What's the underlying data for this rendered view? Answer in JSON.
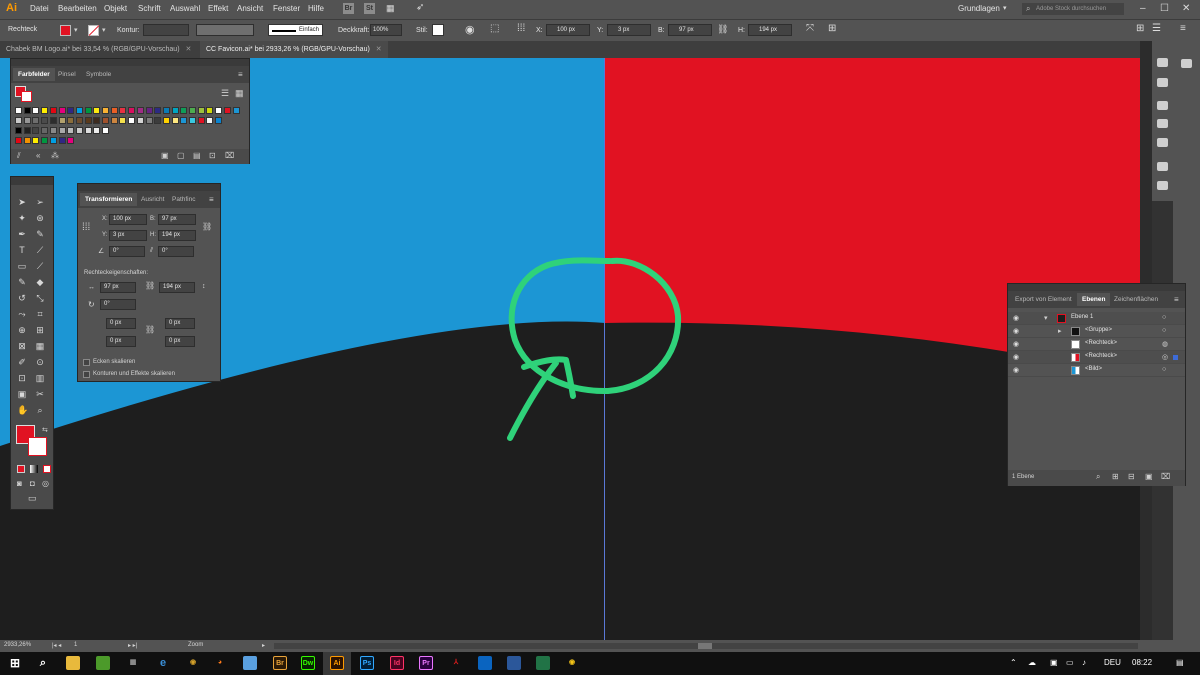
{
  "app": {
    "logo": "Ai"
  },
  "menu": [
    "Datei",
    "Bearbeiten",
    "Objekt",
    "Schrift",
    "Auswahl",
    "Effekt",
    "Ansicht",
    "Fenster",
    "Hilfe"
  ],
  "menu_extra": {
    "bridge": "Br",
    "stock": "St"
  },
  "workspace": {
    "label": "Grundlagen",
    "search_placeholder": "Adobe Stock durchsuchen"
  },
  "control": {
    "selection": "Rechteck",
    "stroke_label": "Kontur:",
    "stroke_style": "Einfach",
    "opacity_label": "Deckkraft:",
    "opacity_value": "100%",
    "style_label": "Stil:",
    "x_label": "X:",
    "x_value": "100 px",
    "y_label": "Y:",
    "y_value": "3 px",
    "b_label": "B:",
    "b_value": "97 px",
    "h_label": "H:",
    "h_value": "194 px"
  },
  "tabs": [
    {
      "label": "Chabek BM Logo.ai* bei 33,54 % (RGB/GPU-Vorschau)"
    },
    {
      "label": "CC Favicon.ai* bei 2933,26 % (RGB/GPU-Vorschau)"
    }
  ],
  "swatches_panel": {
    "tabs": [
      "Farbfelder",
      "Pinsel",
      "Symbole"
    ],
    "row1": [
      "#ffffff",
      "#000000",
      "#ffffff",
      "#ffed00",
      "#e30613",
      "#e6007e",
      "#312783",
      "#009fe3",
      "#009640",
      "#fcea10",
      "#f9b233",
      "#e95f25",
      "#e73142",
      "#d90f5e",
      "#a02c85",
      "#662383",
      "#2c2b81",
      "#0a7cb5",
      "#00a5c2",
      "#0f9d58",
      "#4dac4f",
      "#9dc03d",
      "#d0d90d",
      "#fff",
      "#e11222",
      "#1c96d4"
    ],
    "row2": [
      "#c9c9c9",
      "#959595",
      "#6e6e6e",
      "#4b4b4b",
      "#2d2d2d",
      "#b2a16d",
      "#8a6d3b",
      "#6d4c2e",
      "#5a3a1c",
      "#3d2b1f",
      "#a0522d",
      "#cd853f",
      "#f4e04d",
      "#fff",
      "#d4d4d4",
      "#7f7f7f",
      "#3c3c3c",
      "#ffd200",
      "#ffe880",
      "#1c96d4",
      "#39c8e0",
      "#e11222",
      "#f5f5f5",
      "#0a84d0"
    ],
    "row3": [
      "#000000",
      "#222222",
      "#444444",
      "#666666",
      "#888888",
      "#aaaaaa",
      "#bbbbbb",
      "#cccccc",
      "#dddddd",
      "#eeeeee",
      "#ffffff"
    ],
    "row4": [
      "#e30613",
      "#f39200",
      "#ffed00",
      "#009640",
      "#009fe3",
      "#312783",
      "#e6007e"
    ]
  },
  "transform_panel": {
    "tabs": [
      "Transformieren",
      "Ausricht",
      "Pathfinc"
    ],
    "x_label": "X:",
    "x_value": "100 px",
    "b_label": "B:",
    "b_value": "97 px",
    "y_label": "Y:",
    "y_value": "3 px",
    "h_label": "H:",
    "h_value": "194 px",
    "angle1": "0°",
    "angle2": "0°",
    "rect_props_label": "Rechteckeigenschaften:",
    "rect_w": "97 px",
    "rect_h": "194 px",
    "rotation": "0°",
    "corner1": "0 px",
    "corner2": "0 px",
    "corner3": "0 px",
    "corner4": "0 px",
    "scale_corners": "Ecken skalieren",
    "scale_strokes": "Konturen und Effekte skalieren"
  },
  "layers_panel": {
    "tabs": [
      "Export von Element",
      "Ebenen",
      "Zeichenflächen"
    ],
    "rows": [
      {
        "name": "Ebene 1"
      },
      {
        "name": "<Gruppe>"
      },
      {
        "name": "<Rechteck>"
      },
      {
        "name": "<Rechteck>"
      },
      {
        "name": "<Bild>"
      }
    ],
    "footer": "1 Ebene"
  },
  "status": {
    "zoom": "2933,26%",
    "page": "1",
    "tool": "Zoom"
  },
  "taskbar": {
    "apps": [
      "Br",
      "Dw",
      "Ai",
      "Ps",
      "Id",
      "Pr"
    ],
    "language": "DEU",
    "time": "08:22"
  },
  "colors": {
    "blue": "#1c96d4",
    "red": "#e11222",
    "dark": "#1e1e1e",
    "green_stroke": "#2fd27a",
    "accent_guide": "#5a78d6"
  }
}
